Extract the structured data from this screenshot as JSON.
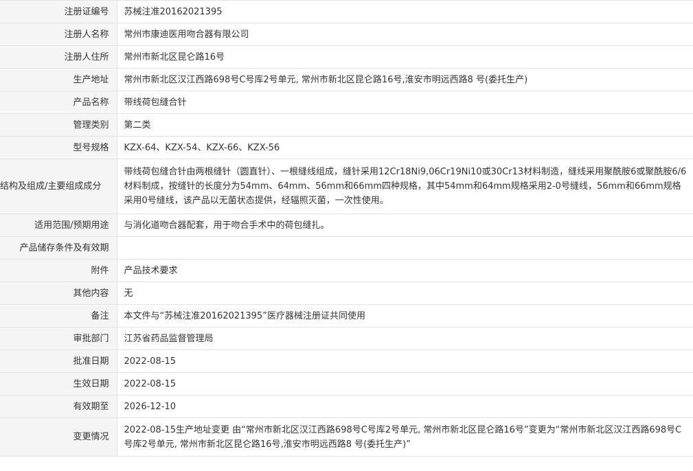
{
  "rows": [
    {
      "label": "注册证编号",
      "value": "苏械注准20162021395"
    },
    {
      "label": "注册人名称",
      "value": "常州市康迪医用吻合器有限公司"
    },
    {
      "label": "注册人住所",
      "value": "常州市新北区昆仑路16号"
    },
    {
      "label": "生产地址",
      "value": "常州市新北区汉江西路698号C号库2号单元, 常州市新北区昆仑路16号,淮安市明远西路8 号(委托生产)"
    },
    {
      "label": "产品名称",
      "value": "带线荷包缝合针"
    },
    {
      "label": "管理类别",
      "value": "第二类"
    },
    {
      "label": "型号规格",
      "value": "KZX-64、KZX-54、KZX-66、KZX-56"
    },
    {
      "label": "结构及组成/主要组成成分",
      "value": "带线荷包缝合针由两根缝针（圆直针）、一根缝线组成，缝针采用12Cr18Ni9,06Cr19Ni10或30Cr13材料制造，缝线采用聚酰胺6或聚酰胺6/6材料制成，按缝针的长度分为54mm、64mm、56mm和66mm四种规格，其中54mm和64mm规格采用2-0号缝线，56mm和66mm规格采用0号缝线，该产品以无菌状态提供，经辐照灭菌，一次性使用。"
    },
    {
      "label": "适用范围/预期用途",
      "value": "与消化道吻合器配套，用于吻合手术中的荷包缝扎。"
    },
    {
      "label": "产品储存条件及有效期",
      "value": ""
    },
    {
      "label": "附件",
      "value": "产品技术要求"
    },
    {
      "label": "其他内容",
      "value": "无"
    },
    {
      "label": "备注",
      "value": "本文件与“苏械注准20162021395”医疗器械注册证共同使用"
    },
    {
      "label": "审批部门",
      "value": "江苏省药品监督管理局"
    },
    {
      "label": "批准日期",
      "value": "2022-08-15"
    },
    {
      "label": "生效日期",
      "value": "2022-08-15"
    },
    {
      "label": "有效期至",
      "value": "2026-12-10"
    },
    {
      "label": "变更情况",
      "value": "2022-08-15生产地址变更 由“常州市新北区汉江西路698号C号库2号单元, 常州市新北区昆仑路16号”变更为“常州市新北区汉江西路698号C号库2号单元, 常州市新北区昆仑路16号,淮安市明远西路8 号(委托生产)”"
    }
  ]
}
